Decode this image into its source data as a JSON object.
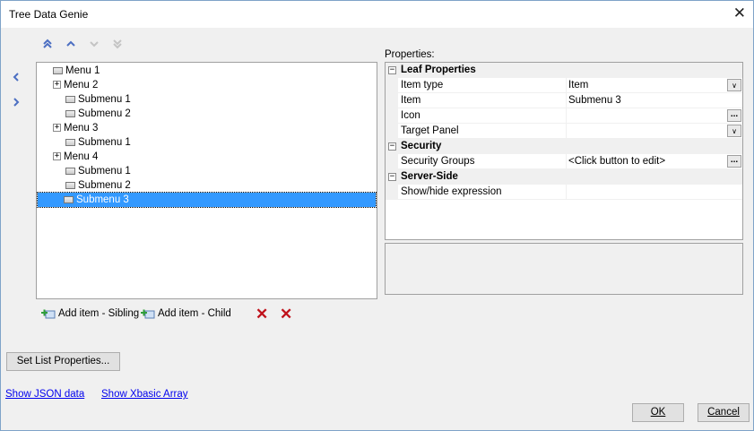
{
  "window": {
    "title": "Tree Data Genie"
  },
  "toolbar": {
    "move_top": "⌃",
    "move_up": "^",
    "move_down": "v",
    "move_bottom": "v"
  },
  "side_nav": {
    "left": "<",
    "right": ">"
  },
  "tree": {
    "items": [
      {
        "label": "Menu 1",
        "level": 0,
        "expander": "",
        "selected": false
      },
      {
        "label": "Menu 2",
        "level": 0,
        "expander": "+",
        "selected": false
      },
      {
        "label": "Submenu 1",
        "level": 1,
        "expander": "",
        "selected": false
      },
      {
        "label": "Submenu 2",
        "level": 1,
        "expander": "",
        "selected": false
      },
      {
        "label": "Menu 3",
        "level": 0,
        "expander": "+",
        "selected": false
      },
      {
        "label": "Submenu 1",
        "level": 1,
        "expander": "",
        "selected": false
      },
      {
        "label": "Menu 4",
        "level": 0,
        "expander": "+",
        "selected": false
      },
      {
        "label": "Submenu 1",
        "level": 1,
        "expander": "",
        "selected": false
      },
      {
        "label": "Submenu 2",
        "level": 1,
        "expander": "",
        "selected": false
      },
      {
        "label": "Submenu 3",
        "level": 1,
        "expander": "",
        "selected": true
      }
    ]
  },
  "properties": {
    "label": "Properties:",
    "categories": {
      "leaf": "Leaf Properties",
      "security": "Security",
      "server": "Server-Side"
    },
    "rows": {
      "item_type": {
        "name": "Item type",
        "value": "Item"
      },
      "item": {
        "name": "Item",
        "value": "Submenu 3"
      },
      "icon": {
        "name": "Icon",
        "value": ""
      },
      "target_panel": {
        "name": "Target Panel",
        "value": ""
      },
      "security_groups": {
        "name": "Security Groups",
        "value": "<Click button to edit>"
      },
      "show_hide": {
        "name": "Show/hide expression",
        "value": ""
      }
    },
    "ellipsis": "...",
    "dropdown": "∨",
    "minus": "−"
  },
  "actions": {
    "add_sibling": "Add item - Sibling",
    "add_child": "Add item - Child",
    "delete_all": "✕",
    "delete": "✕"
  },
  "buttons": {
    "set_list_properties": "Set List Properties...",
    "ok": "OK",
    "cancel": "Cancel"
  },
  "links": {
    "show_json": "Show JSON data",
    "show_xbasic": "Show Xbasic Array"
  },
  "colors": {
    "selection": "#3399ff",
    "accent": "#4c6fc2",
    "delete": "#c0121b"
  }
}
